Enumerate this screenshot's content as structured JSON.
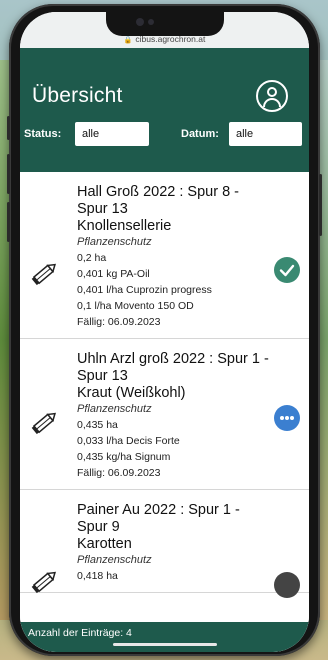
{
  "browser": {
    "url": "cibus.agrochron.at"
  },
  "header": {
    "title": "Übersicht"
  },
  "filters": {
    "status_label": "Status:",
    "status_value": "alle",
    "date_label": "Datum:",
    "date_value": "alle"
  },
  "entries": [
    {
      "name": "Hall Groß 2022 : Spur 8 - Spur 13",
      "crop": "Knollensellerie",
      "type": "Pflanzenschutz",
      "lines": [
        "0,2 ha",
        "0,401 kg PA-Oil",
        "0,401 l/ha Cuprozin progress",
        "0,1 l/ha Movento 150 OD"
      ],
      "due": "Fällig: 06.09.2023",
      "status_icon": "check-icon"
    },
    {
      "name": "Uhln Arzl groß 2022 : Spur 1 - Spur 13",
      "crop": "Kraut (Weißkohl)",
      "type": "Pflanzenschutz",
      "lines": [
        "0,435 ha",
        "0,033 l/ha Decis Forte",
        "0,435 kg/ha Signum"
      ],
      "due": "Fällig: 06.09.2023",
      "status_icon": "more-icon"
    },
    {
      "name": "Painer Au 2022 : Spur 1 - Spur 9",
      "crop": "Karotten",
      "type": "Pflanzenschutz",
      "lines": [
        "0,418 ha"
      ],
      "status_icon": "status-icon"
    }
  ],
  "footer": {
    "count_text": "Anzahl der Einträge: 4"
  },
  "colors": {
    "primary": "#1e5a4c",
    "done": "#3a8a72",
    "open": "#3b7fd0"
  }
}
